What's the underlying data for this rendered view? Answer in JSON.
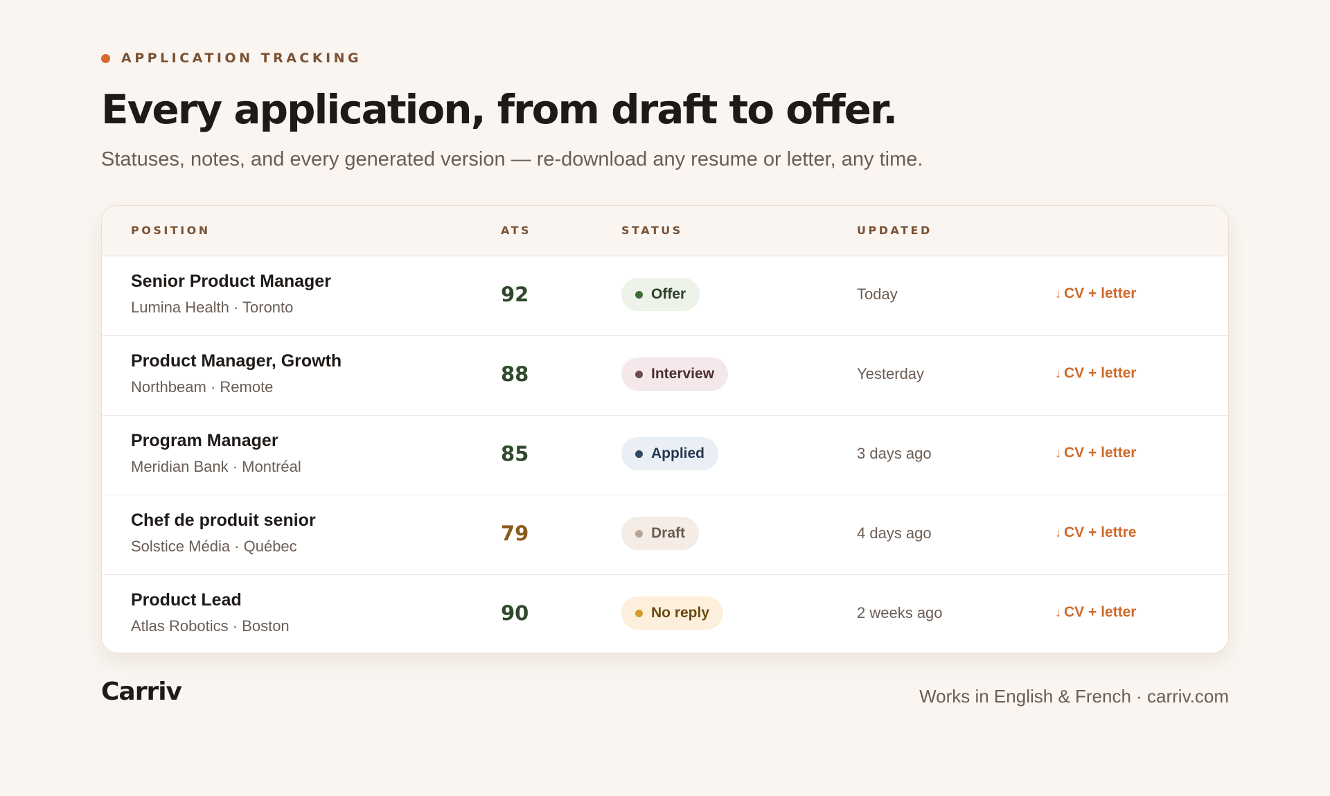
{
  "eyebrow": "APPLICATION TRACKING",
  "headline": "Every application, from draft to offer.",
  "subhead": "Statuses, notes, and every generated version — re-download any resume or letter, any time.",
  "table": {
    "columns": [
      "POSITION",
      "ATS",
      "STATUS",
      "UPDATED"
    ],
    "rows": [
      {
        "title": "Senior Product Manager",
        "subtitle": "Lumina Health · Toronto",
        "ats": "92",
        "ats_color": "#2f4a2b",
        "status": "Offer",
        "status_bg": "#eef3ea",
        "status_dot": "#3f6b3a",
        "status_fg": "#2a3d27",
        "updated": "Today",
        "download": "CV + letter"
      },
      {
        "title": "Product Manager, Growth",
        "subtitle": "Northbeam · Remote",
        "ats": "88",
        "ats_color": "#2f4a2b",
        "status": "Interview",
        "status_bg": "#f4e8ea",
        "status_dot": "#6d4a50",
        "status_fg": "#4a2f34",
        "updated": "Yesterday",
        "download": "CV + letter"
      },
      {
        "title": "Program Manager",
        "subtitle": "Meridian Bank · Montréal",
        "ats": "85",
        "ats_color": "#2f4a2b",
        "status": "Applied",
        "status_bg": "#e9eff5",
        "status_dot": "#2e4a66",
        "status_fg": "#24384f",
        "updated": "3 days ago",
        "download": "CV + letter"
      },
      {
        "title": "Chef de produit senior",
        "subtitle": "Solstice Média · Québec",
        "ats": "79",
        "ats_color": "#8a5a1c",
        "status": "Draft",
        "status_bg": "#f4ece5",
        "status_dot": "#b9a596",
        "status_fg": "#6b5d54",
        "updated": "4 days ago",
        "download": "CV + lettre"
      },
      {
        "title": "Product Lead",
        "subtitle": "Atlas Robotics · Boston",
        "ats": "90",
        "ats_color": "#2f4a2b",
        "status": "No reply",
        "status_bg": "#fcf0dc",
        "status_dot": "#d49a2a",
        "status_fg": "#6b4a12",
        "updated": "2 weeks ago",
        "download": "CV + letter"
      }
    ]
  },
  "icons": {
    "download": "arrow-down-icon",
    "status": "status-dot-icon",
    "eyebrow": "eyebrow-dot-icon"
  },
  "colors": {
    "background": "#faf5f0",
    "accent": "#d9692d",
    "text": "#1f1a17",
    "muted": "#6b5d54"
  },
  "brand": "Carriv",
  "footer": "Works in English & French · carriv.com"
}
